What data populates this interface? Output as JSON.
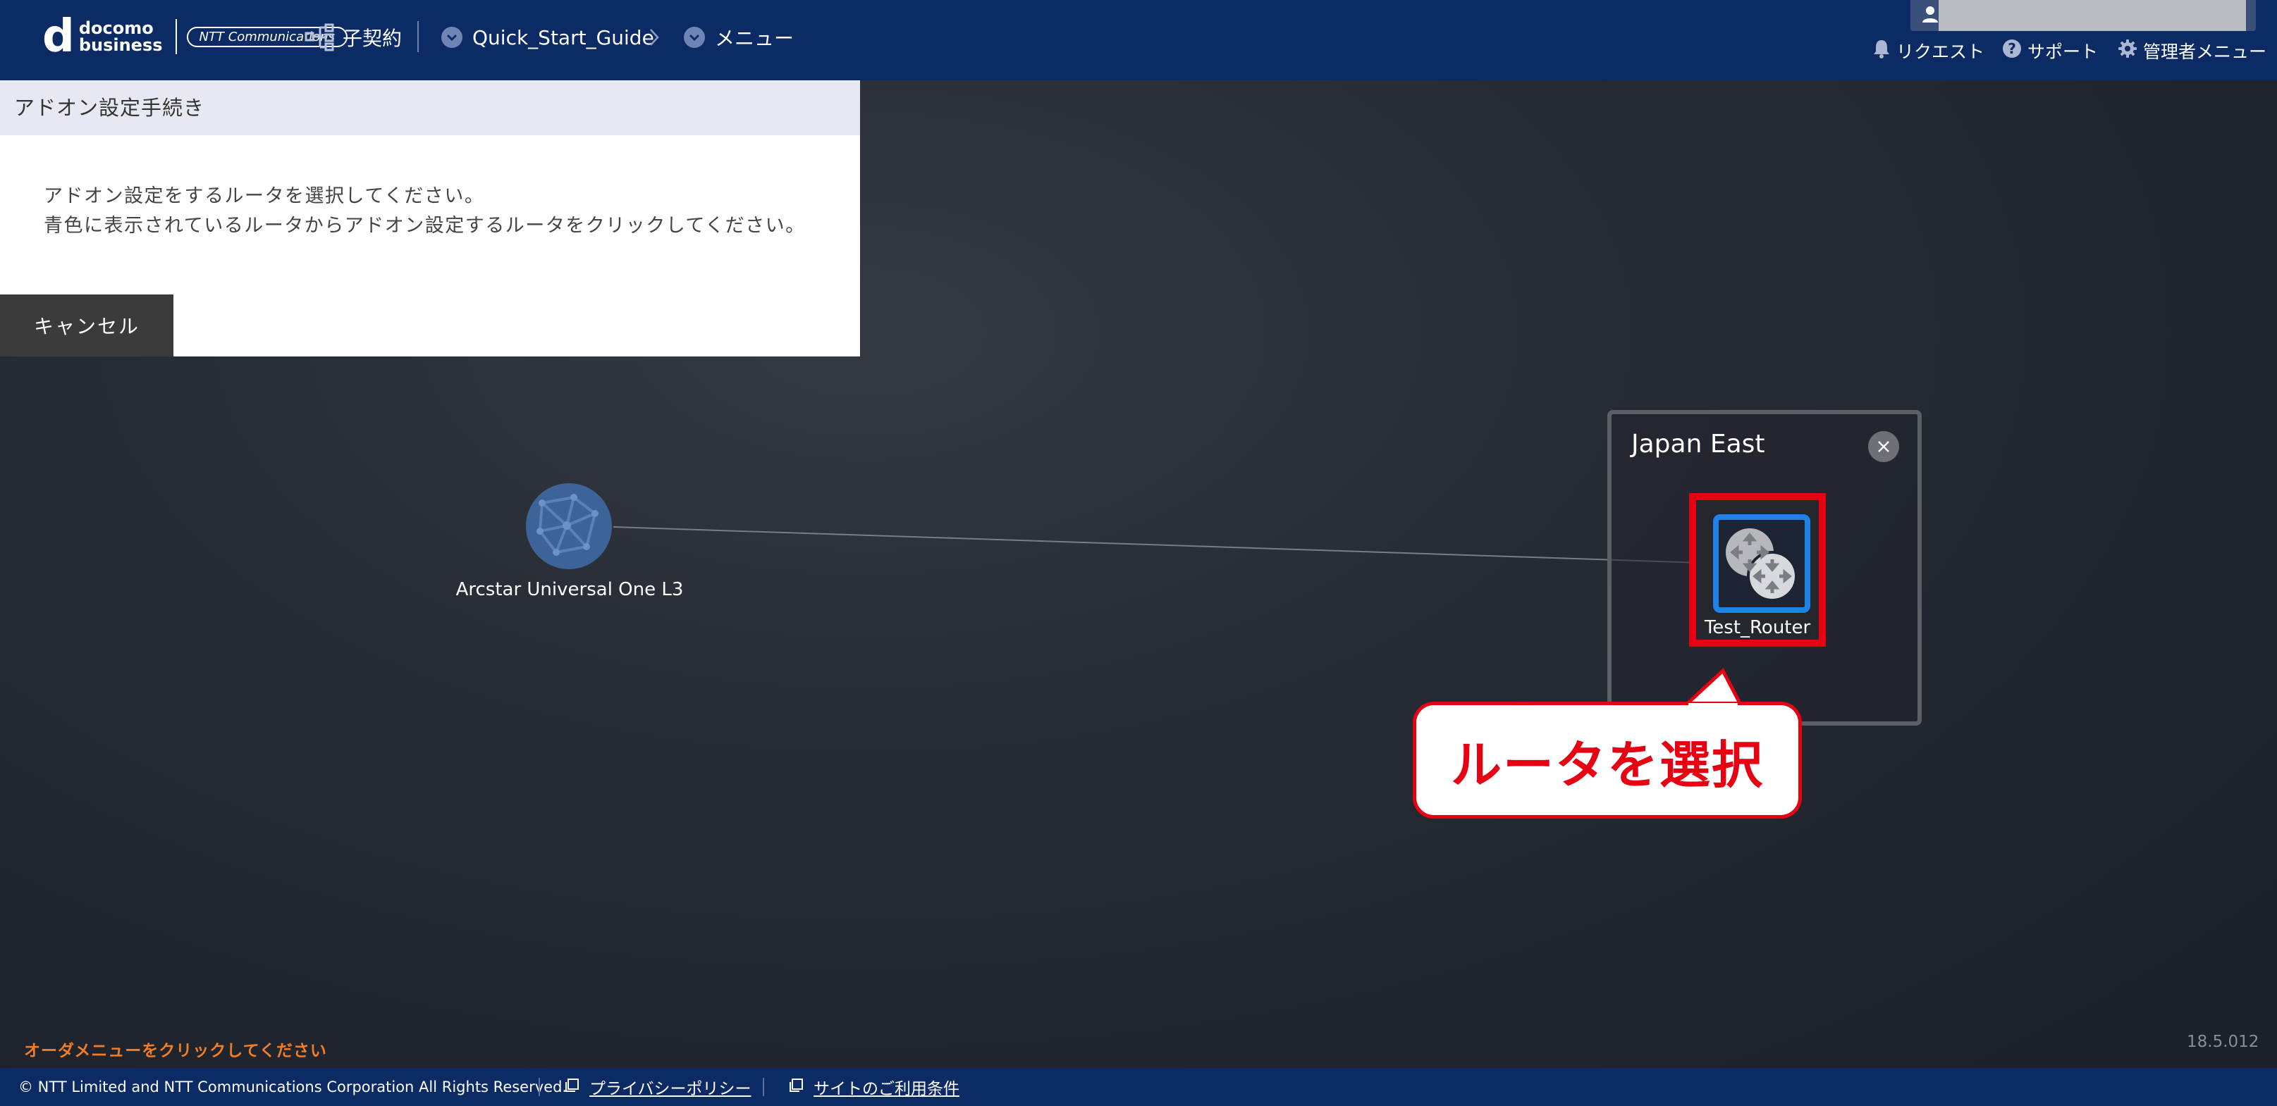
{
  "header": {
    "logo": {
      "mark": "d",
      "line1": "docomo",
      "line2": "business",
      "partner": "NTT Communications"
    },
    "nav": {
      "contract_label": "子契約",
      "breadcrumbs": [
        {
          "label": "Quick_Start_Guide"
        },
        {
          "label": "メニュー"
        }
      ]
    },
    "utility": {
      "request_label": "リクエスト",
      "support_label": "サポート",
      "admin_label": "管理者メニュー"
    }
  },
  "panel": {
    "title": "アドオン設定手続き",
    "instruction_line1": "アドオン設定をするルータを選択してください。",
    "instruction_line2": "青色に表示されているルータからアドオン設定するルータをクリックしてください。",
    "cancel_label": "キャンセル"
  },
  "topology": {
    "cloud_node": {
      "label": "Arcstar Universal One L3",
      "color": "#3d6498"
    },
    "region": {
      "name": "Japan East",
      "router": {
        "label": "Test_Router",
        "state": "selectable",
        "color": "#1e82e6"
      }
    },
    "callout": {
      "text": "ルータを選択",
      "color": "#e60012"
    }
  },
  "status": {
    "order_hint": "オーダメニューをクリックしてください",
    "version": "18.5.012"
  },
  "footer": {
    "copyright": "© NTT Limited and NTT Communications Corporation All Rights Reserved.",
    "privacy_label": "プライバシーポリシー",
    "terms_label": "サイトのご利用条件"
  },
  "colors": {
    "header_bg": "#0c2a63",
    "accent_orange": "#f07d28",
    "highlight_red": "#e60012"
  }
}
